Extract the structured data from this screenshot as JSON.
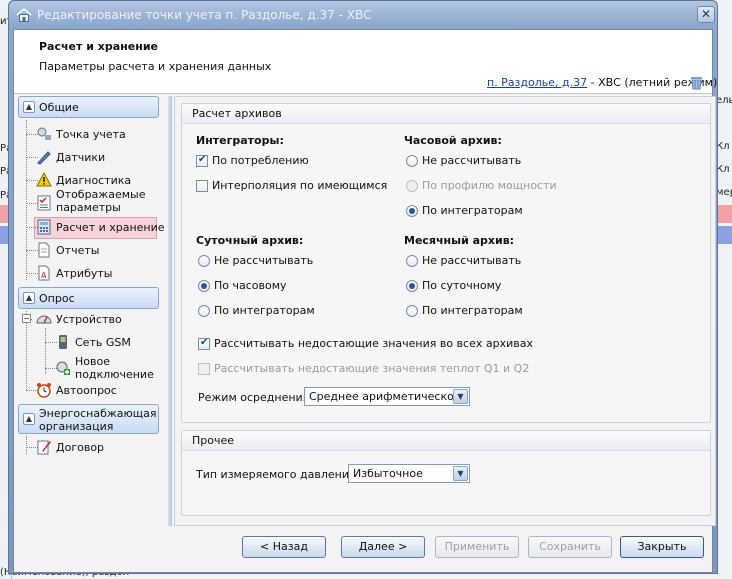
{
  "window": {
    "title": "Редактирование точки учета п. Раздолье, д.37 - ХВС",
    "close_glyph": "✕"
  },
  "header": {
    "title": "Расчет и хранение",
    "subtitle": "Параметры расчета и хранения данных",
    "link_text": "п. Раздолье, д.37",
    "suffix": " - ХВС (летний режим)"
  },
  "nav": {
    "groups": [
      {
        "label": "Общие",
        "items": [
          "Точка учета",
          "Датчики",
          "Диагностика",
          "Отображаемые параметры",
          "Расчет и хранение",
          "Отчеты",
          "Атрибуты"
        ]
      },
      {
        "label": "Опрос",
        "items": [
          "Устройство",
          "Сеть GSM",
          "Новое подключение",
          "Автоопрос"
        ]
      },
      {
        "label": "Энергоснабжающая организация",
        "items": [
          "Договор"
        ]
      }
    ],
    "selected": "Расчет и хранение"
  },
  "archive": {
    "group_title": "Расчет архивов",
    "integrators": {
      "title": "Интеграторы:",
      "options": [
        "По потреблению",
        "Интерполяция по имеющимся"
      ]
    },
    "hourly": {
      "title": "Часовой архив:",
      "options": [
        "Не рассчитывать",
        "По профилю мощности",
        "По интеграторам"
      ]
    },
    "daily": {
      "title": "Суточный архив:",
      "options": [
        "Не рассчитывать",
        "По часовому",
        "По интеграторам"
      ]
    },
    "monthly": {
      "title": "Месячный архив:",
      "options": [
        "Не рассчитывать",
        "По суточному",
        "По интеграторам"
      ]
    },
    "calc_missing_all": "Рассчитывать недостающие значения во всех архивах",
    "calc_missing_heat": "Рассчитывать недостающие значения теплот Q1 и Q2",
    "averaging_label": "Режим осреднения:",
    "averaging_value": "Среднее арифметическое"
  },
  "other": {
    "group_title": "Прочее",
    "pressure_label": "Тип измеряемого давления:",
    "pressure_value": "Избыточное"
  },
  "buttons": {
    "back": "< Назад",
    "next": "Далее >",
    "apply": "Применить",
    "save": "Сохранить",
    "close": "Закрыть"
  },
  "background": {
    "bottom_text": "(Наименование), раздол",
    "right_fragments": [
      "ель",
      "Кл",
      "Кл",
      "мер"
    ],
    "left_fragments": [
      "ит",
      "Ра",
      "Ра",
      "Ра"
    ]
  }
}
